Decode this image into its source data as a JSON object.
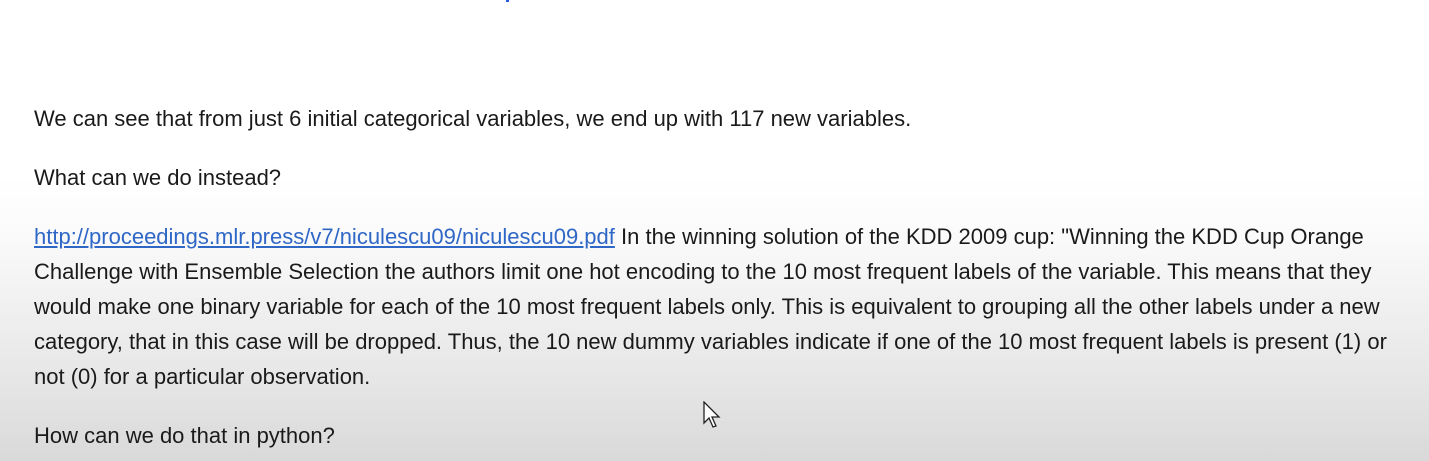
{
  "document": {
    "paragraph_1": "We can see that from just 6 initial categorical variables, we end up with 117 new variables.",
    "paragraph_2": "What can we do instead?",
    "paragraph_3": {
      "link_text": "http://proceedings.mlr.press/v7/niculescu09/niculescu09.pdf",
      "text": " In the winning solution of the KDD 2009 cup: \"Winning the KDD Cup Orange Challenge with Ensemble Selection the authors limit one hot encoding to the 10 most frequent labels of the variable. This means that they would make one binary variable for each of the 10 most frequent labels only. This is equivalent to grouping all the other labels under a new category, that in this case will be dropped. Thus, the 10 new dummy variables indicate if one of the 10 most frequent labels is present (1) or not (0) for a particular observation."
    },
    "paragraph_4": "How can we do that in python?"
  },
  "colors": {
    "link": "#2f67c7",
    "text": "#1a1a1a"
  },
  "icons": {
    "cursor": "mouse-pointer-icon"
  }
}
